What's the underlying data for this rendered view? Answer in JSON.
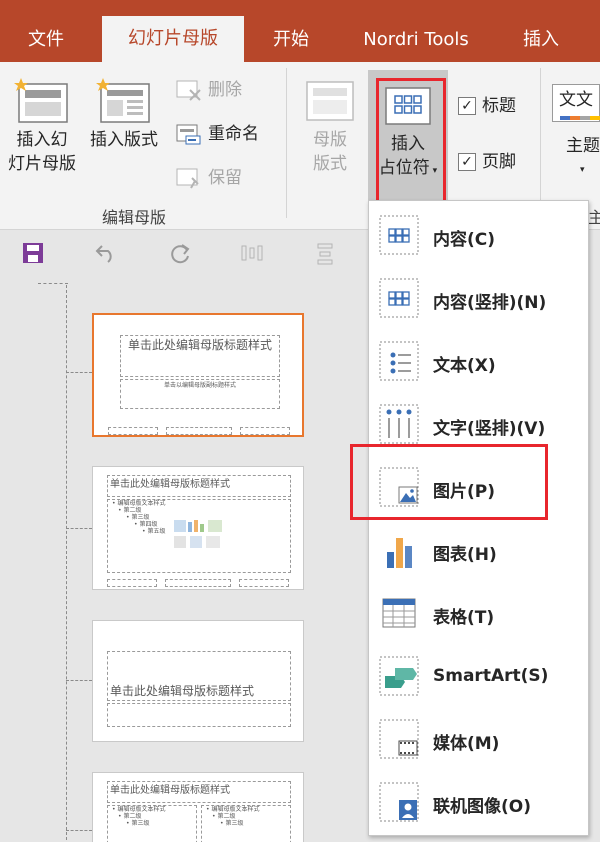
{
  "tabs": [
    {
      "label": "文件"
    },
    {
      "label": "幻灯片母版"
    },
    {
      "label": "开始"
    },
    {
      "label": "Nordri Tools"
    },
    {
      "label": "插入"
    }
  ],
  "ribbon": {
    "insert_master_line1": "插入幻",
    "insert_master_line2": "灯片母版",
    "insert_layout": "插入版式",
    "delete": "删除",
    "rename": "重命名",
    "preserve": "保留",
    "edit_master_group": "编辑母版",
    "master_layout_line1": "母版",
    "master_layout_line2": "版式",
    "insert_placeholder_line1": "插入",
    "insert_placeholder_line2": "占位符",
    "title_checkbox": "标题",
    "title_checked": true,
    "footer_checkbox": "页脚",
    "footer_checked": true,
    "theme_line1": "主题",
    "theme_preview": "文文",
    "group_partial": "主"
  },
  "thumbnails": [
    {
      "title": "单击此处编辑母版标题样式",
      "subtitle": "单击以编辑母版副标题样式"
    },
    {
      "title": "单击此处编辑母版标题样式",
      "body": [
        "• 编辑母版文本样式",
        "• 第二级",
        "• 第三级",
        "• 第四级",
        "• 第五级"
      ]
    },
    {
      "title": "单击此处编辑母版标题样式"
    },
    {
      "title": "单击此处编辑母版标题样式",
      "body": [
        "• 编辑母版文本样式",
        "• 第二级",
        "• 第三级"
      ],
      "body2": [
        "• 编辑母版文本样式",
        "• 第二级",
        "• 第三级"
      ]
    }
  ],
  "dropdown": {
    "items": [
      {
        "label": "内容(C)",
        "icon": "content-icon"
      },
      {
        "label": "内容(竖排)(N)",
        "icon": "content-vertical-icon"
      },
      {
        "label": "文本(X)",
        "icon": "text-icon"
      },
      {
        "label": "文字(竖排)(V)",
        "icon": "text-vertical-icon"
      },
      {
        "label": "图片(P)",
        "icon": "picture-icon"
      },
      {
        "label": "图表(H)",
        "icon": "chart-icon"
      },
      {
        "label": "表格(T)",
        "icon": "table-icon"
      },
      {
        "label": "SmartArt(S)",
        "icon": "smartart-icon"
      },
      {
        "label": "媒体(M)",
        "icon": "media-icon"
      },
      {
        "label": "联机图像(O)",
        "icon": "online-picture-icon"
      }
    ]
  },
  "colors": {
    "tab_bar": "#b7472a",
    "highlight": "#e8262d",
    "selected_thumb": "#e8772e"
  }
}
